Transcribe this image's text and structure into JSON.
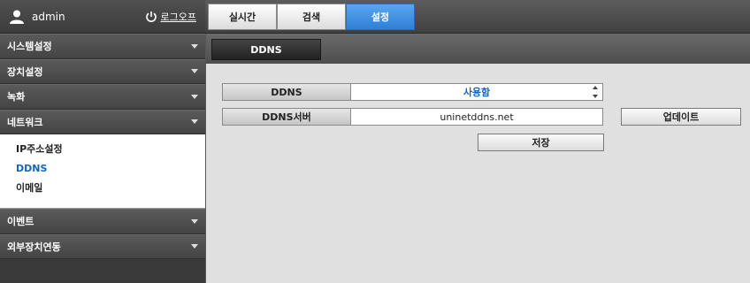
{
  "user": {
    "name": "admin",
    "icon": "user-icon"
  },
  "logout": {
    "label": "로그오프",
    "icon": "power-icon"
  },
  "tabs": [
    {
      "label": "실시간",
      "active": false
    },
    {
      "label": "검색",
      "active": false
    },
    {
      "label": "설정",
      "active": true
    }
  ],
  "sidebar": {
    "items": [
      {
        "label": "시스템설정"
      },
      {
        "label": "장치설정"
      },
      {
        "label": "녹화"
      },
      {
        "label": "네트워크"
      },
      {
        "label": "이벤트"
      },
      {
        "label": "외부장치연동"
      }
    ],
    "submenu": [
      {
        "label": "IP주소설정"
      },
      {
        "label": "DDNS"
      },
      {
        "label": "이메일"
      }
    ]
  },
  "page": {
    "title": "DDNS"
  },
  "form": {
    "ddns_label": "DDNS",
    "ddns_value": "사용함",
    "server_label": "DDNS서버",
    "server_value": "uninetddns.net",
    "update_button": "업데이트",
    "save_button": "저장"
  },
  "colors": {
    "accent": "#2f7fd6",
    "link": "#1565b8"
  }
}
